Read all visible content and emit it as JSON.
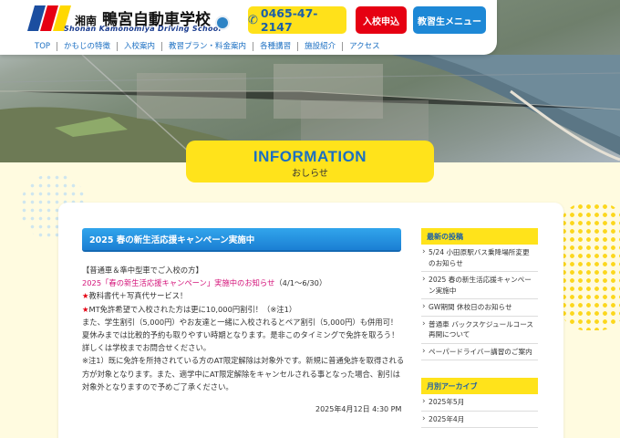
{
  "header": {
    "logo_region": "湘南",
    "logo_name": "鴨宮自動車学校",
    "logo_en": "Shonan Kamonomiya Driving School",
    "tel": "0465-47-2147",
    "apply_label": "入校申込",
    "member_label": "教習生メニュー"
  },
  "nav": [
    "TOP",
    "かもじの特徴",
    "入校案内",
    "教習プラン・料金案内",
    "各種講習",
    "施設紹介",
    "アクセス"
  ],
  "info": {
    "title": "INFORMATION",
    "subtitle": "おしらせ"
  },
  "post": {
    "title": "2025 春の新生活応援キャンペーン実施中",
    "line1": "【普通車＆準中型車でご入校の方】",
    "line2": "2025「春の新生活応援キャンペーン」実施中のお知らせ",
    "line2b": "（4/1～6/30）",
    "line3": "★",
    "line3b": "教科書代＋写真代サービス！",
    "line4": "★",
    "line4b": "MT免許希望で入校された方は更に10,000円割引！（※注1）",
    "line5": "また、学生割引（5,000円）やお友達と一緒に入校されるとペア割引（5,000円）も併用可！　夏休みまでは比較的予約も取りやすい時期となります。是非このタイミングで免許を取ろう！　詳しくは学校までお問合せください。",
    "line6": "※注1）既に免許を所持されている方のAT限定解除は対象外です。新規に普通免許を取得される方が対象となります。また、適学中にAT限定解除をキャンセルされる事となった場合、割引は対象外となりますので予めご了承ください。",
    "date": "2025年4月12日 4:30 PM"
  },
  "sidebar": {
    "recent_title": "最新の投稿",
    "recent": [
      "5/24 小田原駅バス乗降場所変更のお知らせ",
      "2025 春の新生活応援キャンペーン実施中",
      "GW期間 休校日のお知らせ",
      "普通車 バックスケジュールコース再開について",
      "ペーパードライバー講習のご案内"
    ],
    "archive_title": "月別アーカイブ",
    "archive": [
      "2025年5月",
      "2025年4月"
    ]
  },
  "colors": {
    "yellow": "#ffe31b",
    "blue": "#1d88d6",
    "red": "#e60012",
    "pink": "#d4147a"
  },
  "icons": [
    "phone-icon",
    "chevron-right-icon"
  ]
}
